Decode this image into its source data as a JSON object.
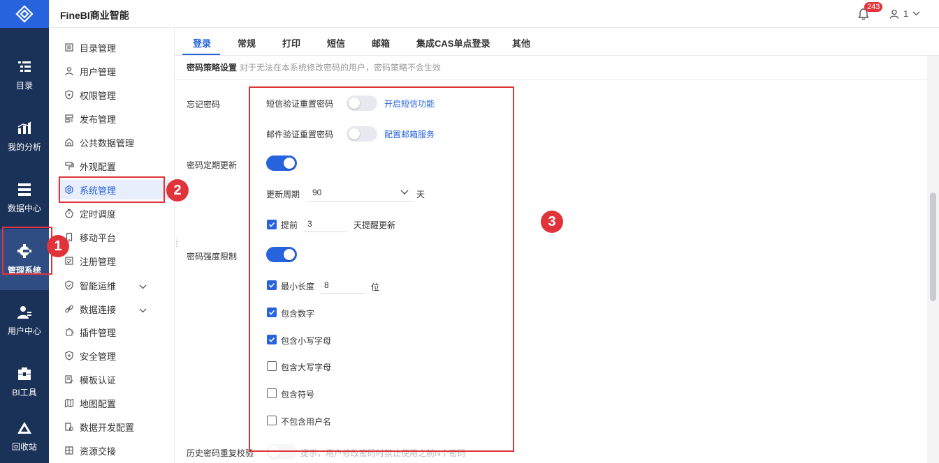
{
  "app": {
    "title": "FineBI商业智能"
  },
  "topbar": {
    "badge": "243",
    "user_label": "1"
  },
  "leftnav": [
    {
      "label": "目录",
      "icon": "catalog-icon"
    },
    {
      "label": "我的分析",
      "icon": "analysis-icon"
    },
    {
      "label": "数据中心",
      "icon": "data-center-icon"
    },
    {
      "label": "管理系统",
      "icon": "gear-icon"
    },
    {
      "label": "用户中心",
      "icon": "user-center-icon"
    },
    {
      "label": "BI工具",
      "icon": "toolbox-icon"
    },
    {
      "label": "回收站",
      "icon": "recycle-icon"
    }
  ],
  "submenu": [
    {
      "label": "目录管理",
      "icon": "list-icon"
    },
    {
      "label": "用户管理",
      "icon": "user-icon"
    },
    {
      "label": "权限管理",
      "icon": "shield-icon"
    },
    {
      "label": "发布管理",
      "icon": "publish-icon"
    },
    {
      "label": "公共数据管理",
      "icon": "public-data-icon"
    },
    {
      "label": "外观配置",
      "icon": "brush-icon"
    },
    {
      "label": "系统管理",
      "icon": "settings-icon"
    },
    {
      "label": "定时调度",
      "icon": "timer-icon"
    },
    {
      "label": "移动平台",
      "icon": "mobile-icon"
    },
    {
      "label": "注册管理",
      "icon": "register-icon"
    },
    {
      "label": "智能运维",
      "icon": "ops-icon"
    },
    {
      "label": "数据连接",
      "icon": "link-icon"
    },
    {
      "label": "插件管理",
      "icon": "plugin-icon"
    },
    {
      "label": "安全管理",
      "icon": "security-icon"
    },
    {
      "label": "模板认证",
      "icon": "template-icon"
    },
    {
      "label": "地图配置",
      "icon": "map-icon"
    },
    {
      "label": "数据开发配置",
      "icon": "dev-config-icon"
    },
    {
      "label": "资源交接",
      "icon": "handover-icon"
    }
  ],
  "tabs": [
    "登录",
    "常规",
    "打印",
    "短信",
    "邮箱",
    "集成CAS单点登录",
    "其他"
  ],
  "section": {
    "title": "密码策略设置",
    "hint": "对于无法在本系统修改密码的用户，密码策略不会生效"
  },
  "forgot_password": {
    "label": "忘记密码",
    "sms_reset": "短信验证重置密码",
    "sms_link": "开启短信功能",
    "email_reset": "邮件验证重置密码",
    "email_link": "配置邮箱服务"
  },
  "periodic_update": {
    "label": "密码定期更新",
    "cycle_label": "更新周期",
    "cycle_value": "90",
    "cycle_unit": "天",
    "advance_label": "提前",
    "advance_value": "3",
    "advance_suffix": "天提醒更新"
  },
  "strength": {
    "label": "密码强度限制",
    "min_length_label": "最小长度",
    "min_length_value": "8",
    "min_length_unit": "位",
    "include_digits": "包含数字",
    "include_lower": "包含小写字母",
    "include_upper": "包含大写字母",
    "include_symbols": "包含符号",
    "exclude_username": "不包含用户名"
  },
  "history": {
    "label": "历史密码重复校验",
    "hint": "提示，用户修改密码时禁止使用之前N个密码"
  },
  "markers": [
    "1",
    "2",
    "3"
  ],
  "colors": {
    "accent": "#2763dd",
    "nav_bg": "#1b3258",
    "highlight": "#e0333a"
  }
}
